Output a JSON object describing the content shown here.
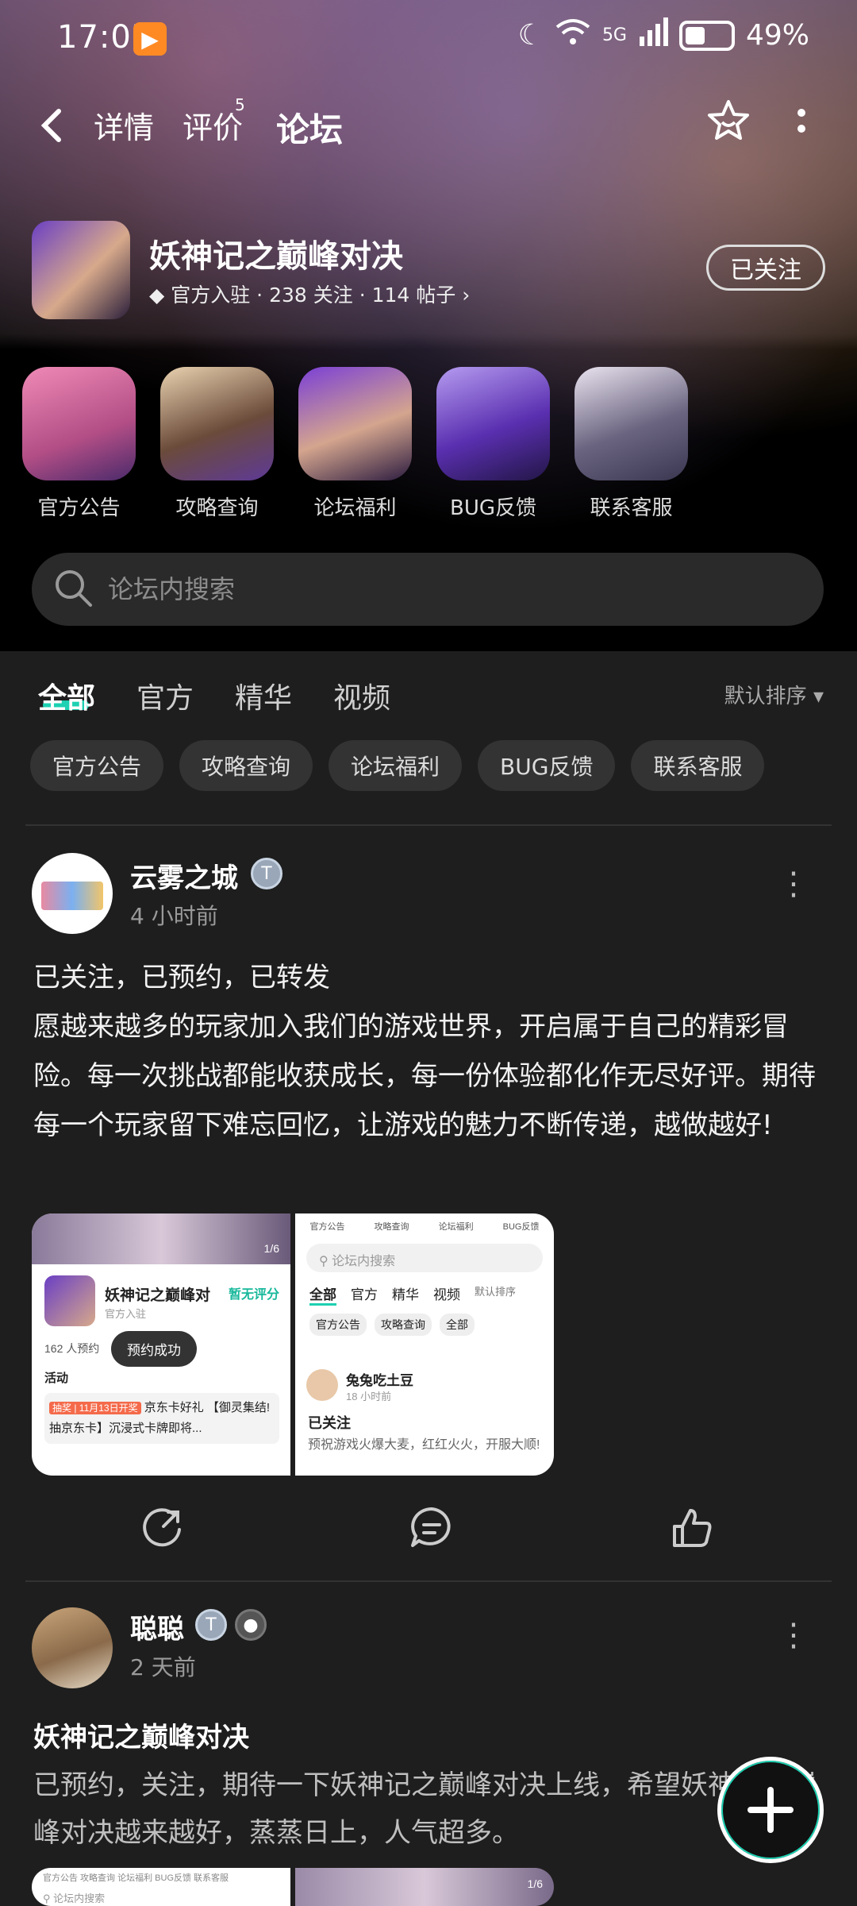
{
  "status": {
    "time": "17:07",
    "battery": "49%",
    "network": "5G"
  },
  "nav": {
    "tabs": [
      {
        "label": "详情"
      },
      {
        "label": "评价",
        "badge": "5"
      },
      {
        "label": "论坛"
      }
    ],
    "active_tab": "论坛"
  },
  "game": {
    "name": "妖神记之巅峰对决",
    "official": "官方入驻",
    "followers": "238 关注",
    "posts": "114 帖子",
    "follow_label": "已关注"
  },
  "shortcuts": [
    {
      "label": "官方公告"
    },
    {
      "label": "攻略查询"
    },
    {
      "label": "论坛福利"
    },
    {
      "label": "BUG反馈"
    },
    {
      "label": "联系客服"
    }
  ],
  "search": {
    "placeholder": "论坛内搜索"
  },
  "content_tabs": [
    {
      "label": "全部"
    },
    {
      "label": "官方"
    },
    {
      "label": "精华"
    },
    {
      "label": "视频"
    }
  ],
  "sort_label": "默认排序",
  "chips": [
    "官方公告",
    "攻略查询",
    "论坛福利",
    "BUG反馈",
    "联系客服"
  ],
  "posts": [
    {
      "user": "云雾之城",
      "time": "4 小时前",
      "text_line1": "已关注，已预约，已转发",
      "text": "愿越来越多的玩家加入我们的游戏世界，开启属于自己的精彩冒险。每一次挑战都能收获成长，每一份体验都化作无尽好评。期待每一个玩家留下难忘回忆，让游戏的魅力不断传递，越做越好!",
      "thumb_left": {
        "page": "1/6",
        "game": "妖神记之巅峰对",
        "rating": "暂无评分",
        "tag": "官方入驻",
        "reserve": "162 人预约",
        "toast": "预约成功",
        "activity": "活动",
        "promo_tag": "抽奖 | 11月13日开奖",
        "promo": "京东卡好礼 【御灵集结! 抽京东卡】沉浸式卡牌即将..."
      },
      "thumb_right": {
        "top": [
          "官方公告",
          "攻略查询",
          "论坛福利",
          "BUG反馈"
        ],
        "search": "论坛内搜索",
        "tabs": [
          "全部",
          "官方",
          "精华",
          "视频"
        ],
        "sort": "默认排序",
        "chips": [
          "官方公告",
          "攻略查询",
          "全部"
        ],
        "user": "兔兔吃土豆",
        "time": "18 小时前",
        "title": "已关注",
        "text": "预祝游戏火爆大麦，红红火火，开服大顺!"
      }
    },
    {
      "user": "聪聪",
      "time": "2 天前",
      "title": "妖神记之巅峰对决",
      "text": "已预约，关注，期待一下妖神记之巅峰对决上线，希望妖神记之巅峰对决越来越好，蒸蒸日上，人气超多。",
      "thumb_left_search": "论坛内搜索",
      "thumb_right_page": "1/6"
    }
  ],
  "colors": {
    "accent": "#1dd1b2",
    "background": "#1e1e1e",
    "chip": "#333333"
  }
}
